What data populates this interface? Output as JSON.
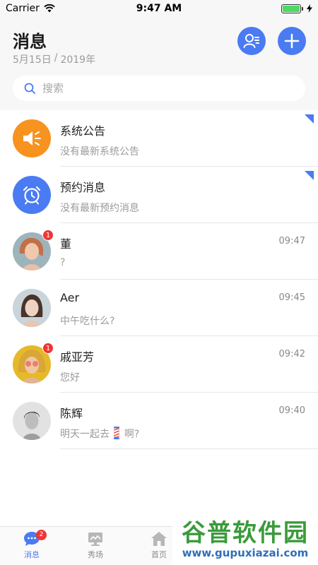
{
  "status_bar": {
    "carrier": "Carrier",
    "time": "9:47 AM"
  },
  "header": {
    "title": "消息",
    "date": "5月15日",
    "date_sep": "/",
    "year": "2019年",
    "search_placeholder": "搜索"
  },
  "messages": [
    {
      "name": "系统公告",
      "preview": "没有最新系统公告",
      "time": "",
      "badge": "",
      "avatar_color": "#f7931e",
      "icon": "speaker-icon"
    },
    {
      "name": "预约消息",
      "preview": "没有最新预约消息",
      "time": "",
      "badge": "",
      "avatar_color": "#4a7bf2",
      "icon": "alarm-clock-icon"
    },
    {
      "name": "董",
      "preview": "?",
      "time": "09:47",
      "badge": "1",
      "avatar_color": "#c98b6b"
    },
    {
      "name": "Aer",
      "preview": "中午吃什么?",
      "time": "09:45",
      "badge": "",
      "avatar_color": "#b6c3cc"
    },
    {
      "name": "戚亚芳",
      "preview": "您好",
      "time": "09:42",
      "badge": "1",
      "avatar_color": "#e2b22a"
    },
    {
      "name": "陈辉",
      "preview": "明天一起去",
      "preview_suffix": "啊?",
      "preview_emoji": "barber-pole-icon",
      "time": "09:40",
      "badge": "",
      "avatar_color": "#bdbdbd"
    }
  ],
  "tabs": [
    {
      "label": "消息",
      "badge": "2",
      "icon": "chat-bubble-icon"
    },
    {
      "label": "秀场",
      "icon": "showcase-icon"
    },
    {
      "label": "首页",
      "icon": "home-icon"
    }
  ],
  "watermark": {
    "top": "谷普软件园",
    "bottom": "www.gupuxiazai.com"
  },
  "colors": {
    "accent": "#4a7bf2",
    "badge": "#f03535",
    "notice": "#f7931e",
    "header_bg": "#f7f7f7"
  }
}
